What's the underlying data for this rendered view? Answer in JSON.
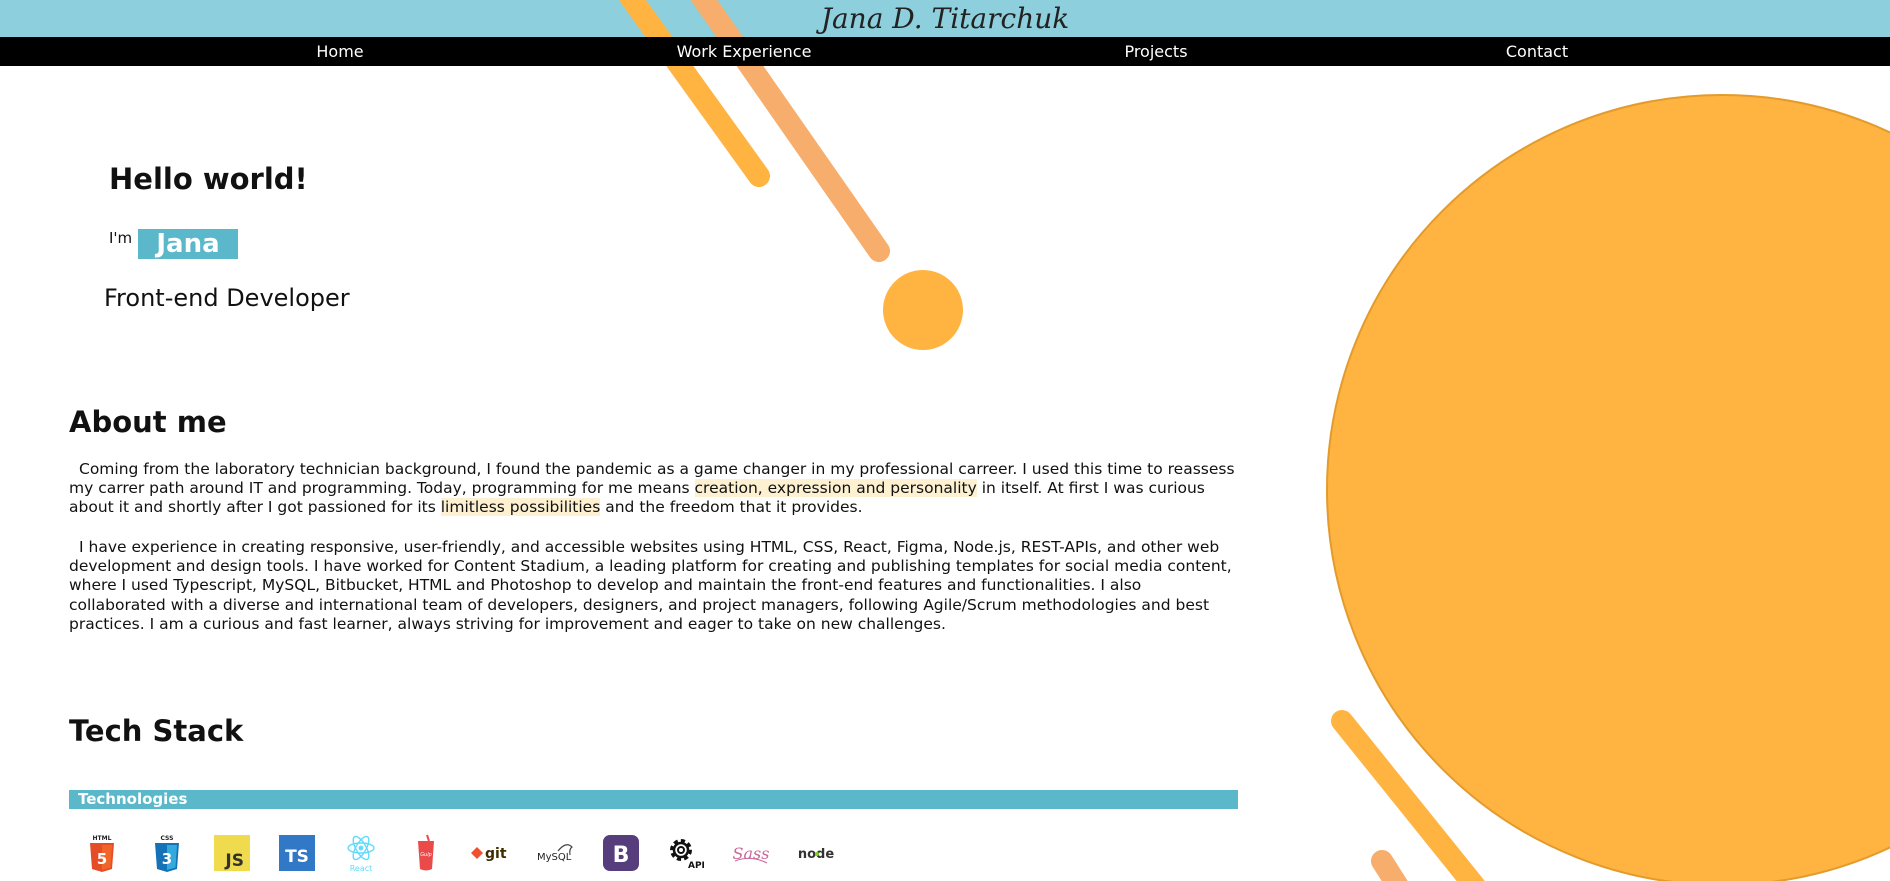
{
  "header": {
    "title": "Jana D. Titarchuk"
  },
  "nav": {
    "items": [
      "Home",
      "Work Experience",
      "Projects",
      "Contact"
    ]
  },
  "hero": {
    "greeting": "Hello world!",
    "im_prefix": "I'm",
    "name": "Jana",
    "role": "Front-end Developer"
  },
  "about": {
    "heading": "About me",
    "p1_a": "Coming from the laboratory technician background, I found the pandemic as a game changer in my professional carreer. I used this time to reassess my carrer path around IT and programming. Today, programming for me means ",
    "p1_hl1": "creation, expression and personality",
    "p1_b": " in itself. At first I was curious about it and shortly after I got passioned for its ",
    "p1_hl2": "limitless possibilities",
    "p1_c": " and the freedom that it provides.",
    "p2": "I have experience in creating responsive, user-friendly, and accessible websites using HTML, CSS, React, Figma, Node.js, REST-APIs, and other web development and design tools. I have worked for Content Stadium, a leading platform for creating and publishing templates for social media content, where I used Typescript, MySQL, Bitbucket, HTML and Photoshop to develop and maintain the front-end features and functionalities. I also collaborated with a diverse and international team of developers, designers, and project managers, following Agile/Scrum methodologies and best practices. I am a curious and fast learner, always striving for improvement and eager to take on new challenges."
  },
  "tech": {
    "heading": "Tech Stack",
    "bar_label": "Technologies",
    "icons": {
      "html": "HTML",
      "css": "CSS",
      "js": "JS",
      "ts": "TS",
      "react": "React",
      "gulp": "Gulp",
      "git": "git",
      "mysql": "MySQL",
      "bootstrap": "B",
      "api": "API",
      "sass": "Sass",
      "node": "node"
    }
  },
  "colors": {
    "header_bg": "#8dcfdc",
    "accent_teal": "#5bb8ca",
    "accent_orange": "#ffb341",
    "highlight": "#fdf1d2"
  }
}
